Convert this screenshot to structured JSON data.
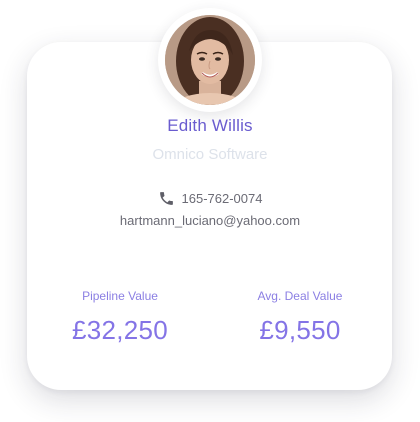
{
  "contact": {
    "name": "Edith Willis",
    "company": "Omnico Software",
    "phone": "165-762-0074",
    "email": "hartmann_luciano@yahoo.com",
    "avatar_icon": "profile-photo"
  },
  "stats": {
    "pipeline_label": "Pipeline Value",
    "pipeline_value": "£32,250",
    "avg_deal_label": "Avg. Deal Value",
    "avg_deal_value": "£9,550"
  },
  "colors": {
    "accent": "#6a5ccf",
    "stat_purple": "#8474e6",
    "muted_text": "#6b6b75",
    "faded_text": "#dde2ea"
  },
  "icons": {
    "phone": "phone-icon"
  }
}
